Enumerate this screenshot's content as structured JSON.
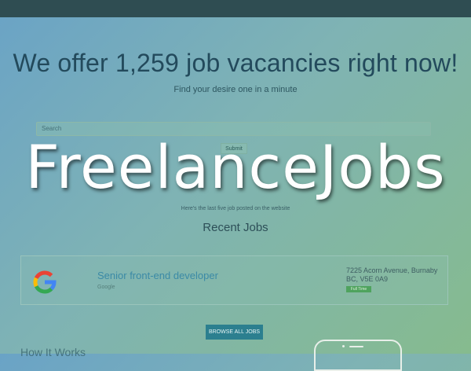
{
  "hero": {
    "title": "We offer 1,259 job vacancies right now!",
    "subtitle": "Find your desire one in a minute"
  },
  "search": {
    "placeholder": "Search",
    "submit_label": "Submit"
  },
  "watermark": "FreelanceJobs",
  "recent": {
    "note": "Here's the last five job posted on the website",
    "title": "Recent Jobs"
  },
  "jobs": [
    {
      "logo": "google-logo",
      "title": "Senior front-end developer",
      "company": "Google",
      "address": "7225 Acorn Avenue, Burnaby BC, V5E 0A9",
      "type": "Full Time"
    }
  ],
  "browse_label": "BROWSE ALL JOBS",
  "how_heading": "How It Works",
  "colors": {
    "topbar": "#2f4d52",
    "accent": "#2c7f8f",
    "badge": "#4fa35e"
  }
}
